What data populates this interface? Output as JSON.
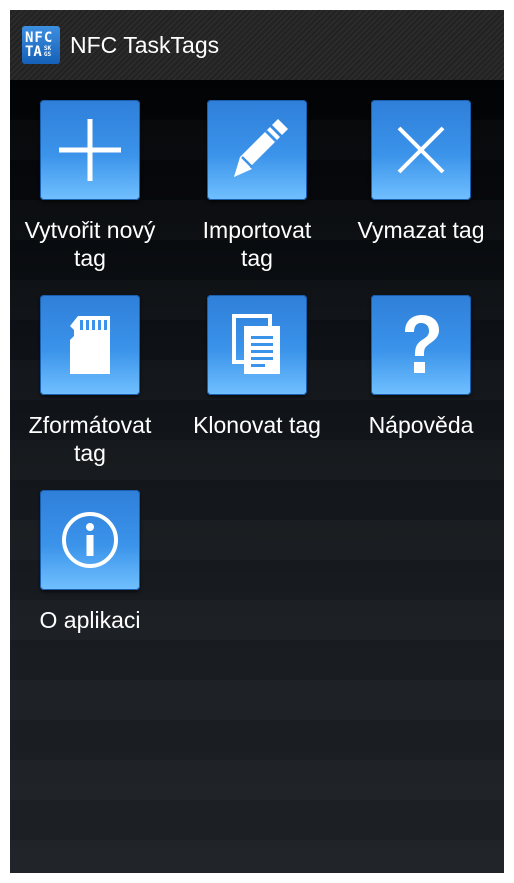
{
  "app": {
    "logo_line1": "NFC",
    "logo_line2": "TA",
    "logo_mini": "SKGS",
    "title": "NFC TaskTags"
  },
  "tiles": [
    {
      "label": "Vytvořit nový\ntag",
      "icon": "plus-icon"
    },
    {
      "label": "Importovat\ntag",
      "icon": "pencil-icon"
    },
    {
      "label": "Vymazat tag",
      "icon": "x-icon"
    },
    {
      "label": "Zformátovat\ntag",
      "icon": "sd-card-icon"
    },
    {
      "label": "Klonovat tag",
      "icon": "copy-documents-icon"
    },
    {
      "label": "Nápověda",
      "icon": "question-mark-icon"
    },
    {
      "label": "O aplikaci",
      "icon": "info-icon"
    }
  ],
  "colors": {
    "tile_top": "#2f7fd9",
    "tile_bottom": "#71c0ff",
    "action_bar": "#2b2b2b",
    "background": "#000000",
    "text": "#ffffff"
  }
}
